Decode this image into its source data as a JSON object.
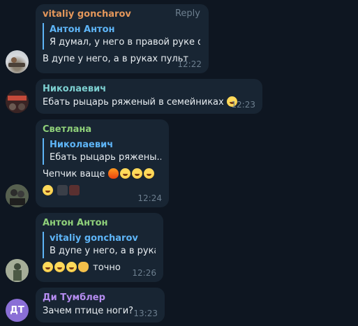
{
  "reply_label": "Reply",
  "messages": [
    {
      "sender": "vitaliy goncharov",
      "sender_color": "#e4975b",
      "quote_sender": "Антон Антон",
      "quote_text": "Я думал, у него в правой руке фа...",
      "text": "В дупе у него, а в руках пульт",
      "time": "12:22"
    },
    {
      "sender": "Николаевич",
      "sender_color": "#7ccfd0",
      "text": "Ебать рыцарь ряженый в семейниках",
      "emoji": "rolling-laughing",
      "time": "12:23"
    },
    {
      "sender": "Светлана",
      "sender_color": "#8fd17a",
      "quote_sender": "Николаевич",
      "quote_text": "Ебать рыцарь ряжены...",
      "text": "Чепчик ваще",
      "emoji": [
        "fire",
        "rolling-laughing",
        "rolling-laughing",
        "rolling-laughing",
        "rolling-laughing",
        "sticker",
        "sticker"
      ],
      "time": "12:24"
    },
    {
      "sender": "Антон Антон",
      "sender_color": "#8fd17a",
      "quote_sender": "vitaliy goncharov",
      "quote_text": "В дупе у него, а в рука...",
      "emoji": [
        "grinning-sweat",
        "grinning-sweat",
        "grinning-sweat",
        "ok-hand"
      ],
      "text": "точно",
      "time": "12:26"
    },
    {
      "sender": "Ди Тумблер",
      "sender_color": "#b58cf0",
      "avatar_initials": "ДТ",
      "avatar_color": "#8a6fd6",
      "text": "Зачем птице ноги?",
      "time": "13:23"
    }
  ]
}
